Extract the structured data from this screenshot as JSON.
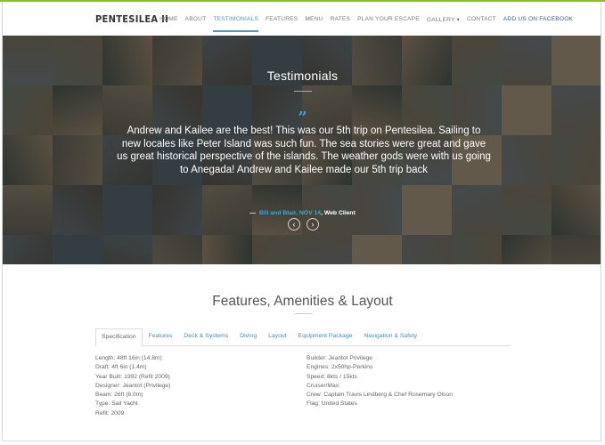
{
  "logo": "PENTESILEA II",
  "nav": [
    {
      "label": "HOME"
    },
    {
      "label": "ABOUT"
    },
    {
      "label": "TESTIMONIALS",
      "active": true
    },
    {
      "label": "FEATURES"
    },
    {
      "label": "MENU"
    },
    {
      "label": "RATES"
    },
    {
      "label": "PLAN YOUR ESCAPE"
    },
    {
      "label": "GALLERY",
      "dropdown": "▾"
    },
    {
      "label": "CONTACT"
    },
    {
      "label": "ADD US ON FACEBOOK"
    }
  ],
  "hero": {
    "title": "Testimonials",
    "quote_icon": "”",
    "quote": "Andrew and Kailee are the best!  This was our 5th trip on Pentesilea.  Sailing to new locales like Peter Island was such fun.  The sea stories were great and gave us great historical perspective of the islands.  The weather gods were with us going to Anegada!    Andrew and Kailee made our 5th trip back",
    "attribution_dash": "—",
    "attribution_author": "Bill and Blair, NOV 14",
    "attribution_source": ", Web Client",
    "prev_icon": "‹",
    "next_icon": "›"
  },
  "features": {
    "title": "Features, Amenities & Layout",
    "tabs": [
      {
        "label": "Specification",
        "active": true
      },
      {
        "label": "Features"
      },
      {
        "label": "Deck & Systems"
      },
      {
        "label": "Diving"
      },
      {
        "label": "Layout"
      },
      {
        "label": "Equipment Package"
      },
      {
        "label": "Navigation & Safety"
      }
    ],
    "specs_left": [
      "Length: 48ft 16in (14.8m)",
      "Draft: 4ft 6in (1.4m)",
      "Year Built: 1992 (Refit 2009)",
      "Designer: Jeantot (Privilege)",
      "Beam: 26ft (8.0m)",
      "Type: Sail Yacht",
      "Refit: 2009"
    ],
    "specs_right": [
      "Builder: Jeantot Privilege",
      "Engines: 2x50hp-Perkins",
      "Speed: 8kts / 15kts",
      "Cruiser/Max:",
      "Crew: Captain Travis Lindberg & Chef Rosemary Olson",
      "Flag: United States"
    ]
  },
  "colors": {
    "accent": "#4f97c8",
    "quote_accent": "#3ea6dc",
    "facebook": "#3d5a98"
  }
}
